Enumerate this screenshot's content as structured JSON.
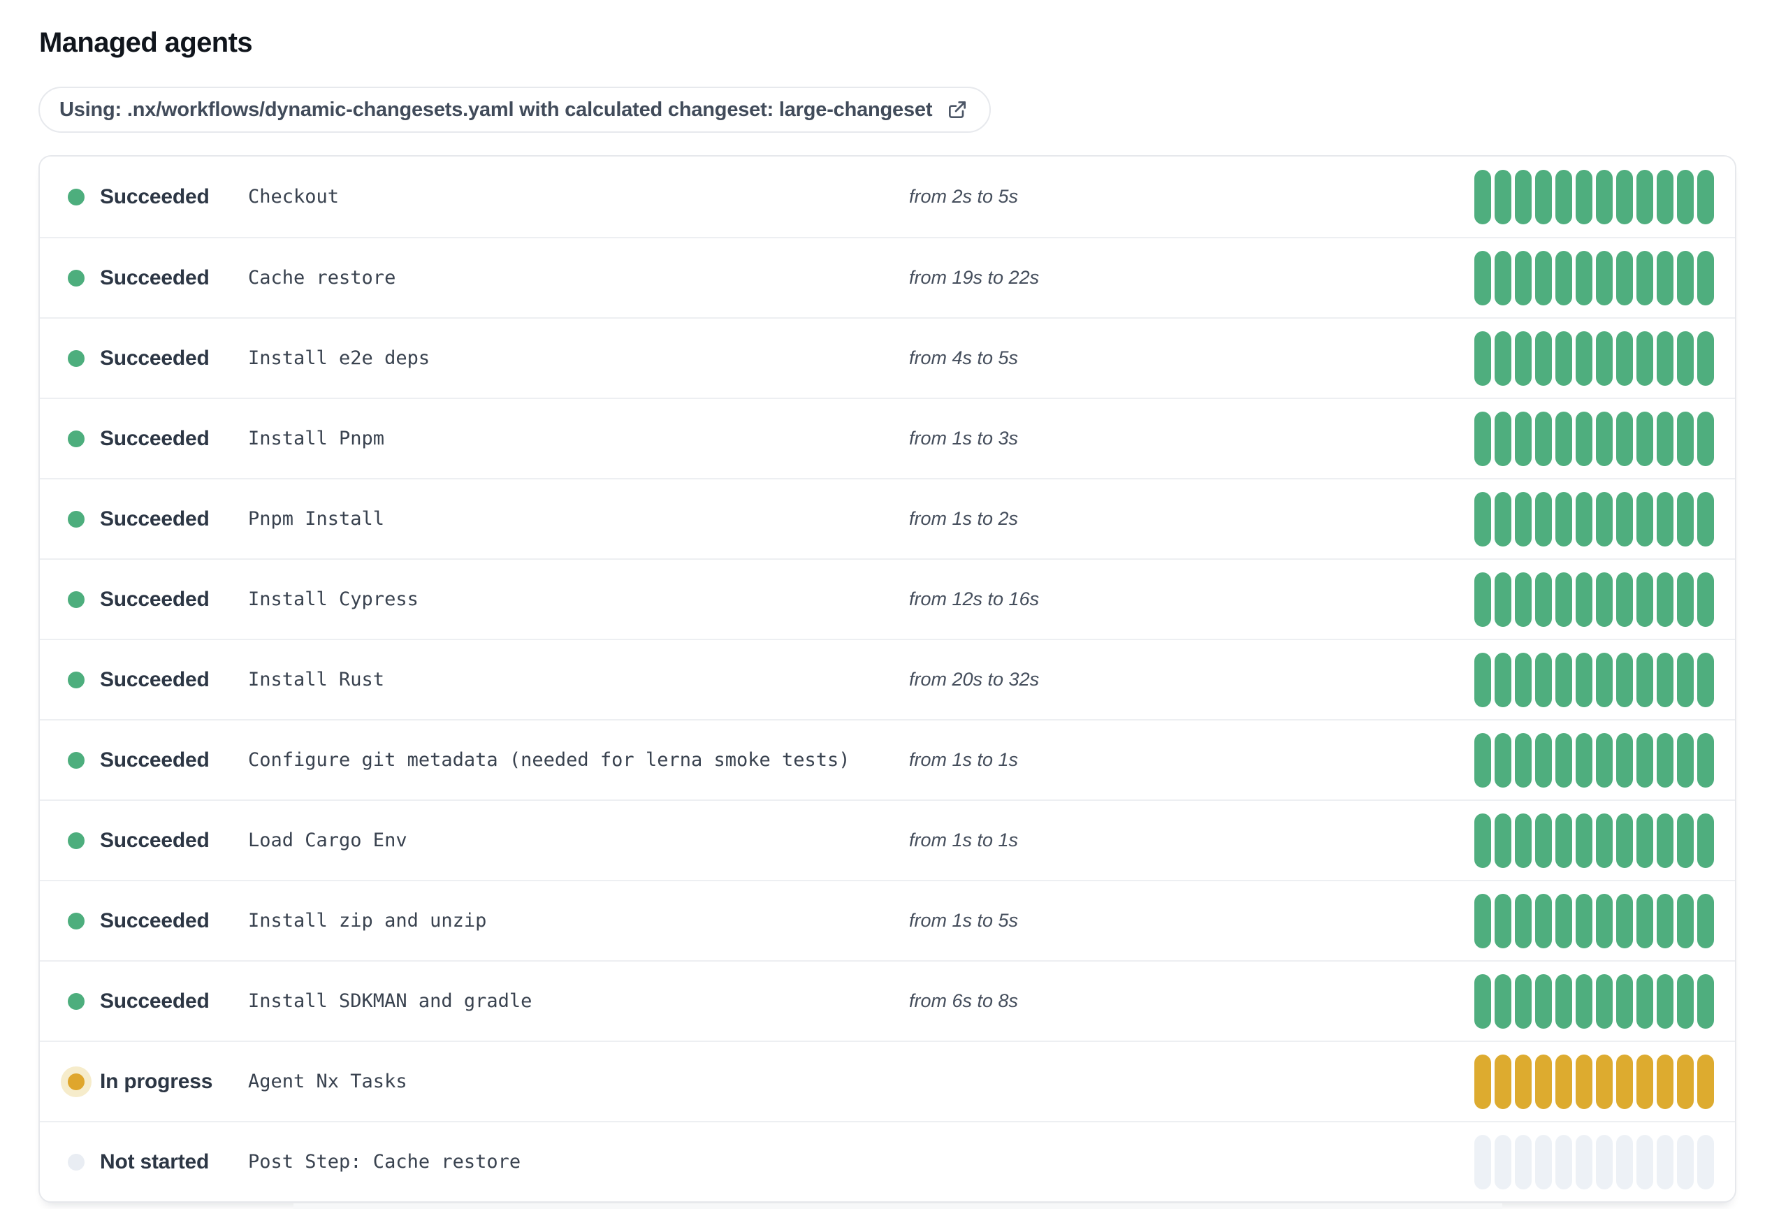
{
  "page": {
    "title": "Managed agents"
  },
  "workflow_chip": {
    "label": "Using: .nx/workflows/dynamic-changesets.yaml with calculated changeset: large-changeset",
    "icon": "external-link-icon"
  },
  "colors": {
    "success": "#4FAE7E",
    "in_progress": "#DDAB2F",
    "in_progress_halo": "#F6ECCB",
    "not_started": "#EDF1F6",
    "card_border": "#E6E8EC",
    "row_divider": "#EDEFF2",
    "status_text": "#2C3644",
    "step_text": "#39424F",
    "duration_text": "#454E5C"
  },
  "agents": {
    "bars_per_row": 12,
    "rows": [
      {
        "state": "succeeded",
        "status": "Succeeded",
        "name": "Checkout",
        "duration": "from 2s to 5s"
      },
      {
        "state": "succeeded",
        "status": "Succeeded",
        "name": "Cache restore",
        "duration": "from 19s to 22s"
      },
      {
        "state": "succeeded",
        "status": "Succeeded",
        "name": "Install e2e deps",
        "duration": "from 4s to 5s"
      },
      {
        "state": "succeeded",
        "status": "Succeeded",
        "name": "Install Pnpm",
        "duration": "from 1s to 3s"
      },
      {
        "state": "succeeded",
        "status": "Succeeded",
        "name": "Pnpm Install",
        "duration": "from 1s to 2s"
      },
      {
        "state": "succeeded",
        "status": "Succeeded",
        "name": "Install Cypress",
        "duration": "from 12s to 16s"
      },
      {
        "state": "succeeded",
        "status": "Succeeded",
        "name": "Install Rust",
        "duration": "from 20s to 32s"
      },
      {
        "state": "succeeded",
        "status": "Succeeded",
        "name": "Configure git metadata (needed for lerna smoke tests)",
        "duration": "from 1s to 1s"
      },
      {
        "state": "succeeded",
        "status": "Succeeded",
        "name": "Load Cargo Env",
        "duration": "from 1s to 1s"
      },
      {
        "state": "succeeded",
        "status": "Succeeded",
        "name": "Install zip and unzip",
        "duration": "from 1s to 5s"
      },
      {
        "state": "succeeded",
        "status": "Succeeded",
        "name": "Install SDKMAN and gradle",
        "duration": "from 6s to 8s"
      },
      {
        "state": "in-progress",
        "status": "In progress",
        "name": "Agent Nx Tasks",
        "duration": ""
      },
      {
        "state": "not-started",
        "status": "Not started",
        "name": "Post Step: Cache restore",
        "duration": ""
      }
    ]
  }
}
